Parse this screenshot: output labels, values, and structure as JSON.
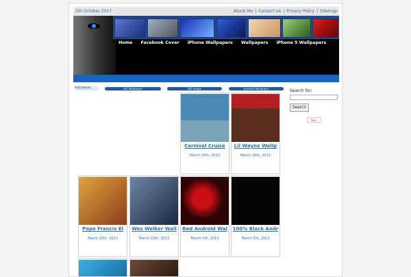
{
  "topbar": {
    "date": "5th October 2017",
    "links": [
      "About Me",
      "Contact Us",
      "Privacy Policy",
      "Sitemap"
    ]
  },
  "nav": [
    "Home",
    "Facebook Cover",
    "iPhone Wallpapers",
    "Wallpapers",
    "iPhone 5 Wallpapers"
  ],
  "ad_label": "AdChoices",
  "pills": [
    "HD Wallpaper",
    "HD Image",
    "Android Wallpaper"
  ],
  "cards": [
    {
      "title": "Carnival Cruise",
      "date": "March 16th, 2013",
      "color": "#4c89b2"
    },
    {
      "title": "Lil Wayne Wallp",
      "date": "March 16th, 2013",
      "color": "#b21f24"
    },
    {
      "title": "Pope Francis El",
      "date": "March 15th, 2013",
      "color": "#c97a24"
    },
    {
      "title": "Wes Welker Wall",
      "date": "March 15th, 2013",
      "color": "#283e63"
    },
    {
      "title": "Red Android Wal",
      "date": "March 5th, 2013",
      "color": "#2d0306"
    },
    {
      "title": "100% Black Andr",
      "date": "March 5th, 2013",
      "color": "#050505"
    }
  ],
  "sidebar": {
    "label": "Search for:",
    "button": "Search"
  },
  "gplus": "G+"
}
